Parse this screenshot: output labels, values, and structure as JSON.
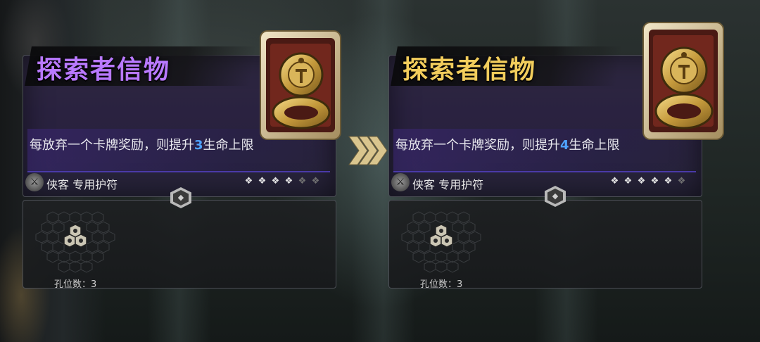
{
  "before": {
    "title": "探索者信物",
    "title_color": "#b979ff",
    "desc_prefix": "每放弃一个卡牌奖励，则提升",
    "desc_value": "3",
    "desc_suffix": "生命上限",
    "class_label": "侠客 专用护符",
    "stars_filled": 4,
    "stars_total": 6,
    "slots_label": "孔位数：3"
  },
  "after": {
    "title": "探索者信物",
    "title_color": "#f2cd5c",
    "desc_prefix": "每放弃一个卡牌奖励，则提升",
    "desc_value": "4",
    "desc_suffix": "生命上限",
    "class_label": "侠客 专用护符",
    "stars_filled": 5,
    "stars_total": 6,
    "slots_label": "孔位数：3"
  },
  "icons": {
    "class_icon": "rogue-class-icon",
    "star_icon": "upgrade-star-icon",
    "arrow_icon": "triple-chevron-right-icon",
    "artifact_icon": "golden-ring-icon",
    "slot_icon": "hex-socket-icon"
  },
  "colors": {
    "value_blue": "#4fa3ff",
    "arrow_gold": "#d9c58e"
  }
}
